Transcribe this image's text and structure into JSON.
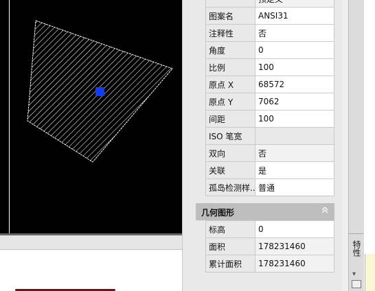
{
  "canvas": {
    "grip_color": "#0d3cff"
  },
  "properties": {
    "top_rows": [
      {
        "key": "",
        "value": "预定义"
      },
      {
        "key": "图案名",
        "value": "ANSI31"
      },
      {
        "key": "注释性",
        "value": "否"
      },
      {
        "key": "角度",
        "value": "0"
      },
      {
        "key": "比例",
        "value": "100"
      },
      {
        "key": "原点 X",
        "value": "68572"
      },
      {
        "key": "原点 Y",
        "value": "7062"
      },
      {
        "key": "间距",
        "value": "100"
      },
      {
        "key": "ISO 笔宽",
        "value": ""
      },
      {
        "key": "双向",
        "value": "否"
      },
      {
        "key": "关联",
        "value": "是"
      },
      {
        "key": "孤岛检测样...",
        "value": "普通"
      }
    ],
    "geometry": {
      "title": "几何图形",
      "collapse_icon": "chevron-up-icon",
      "rows": [
        {
          "key": "标高",
          "value": "0"
        },
        {
          "key": "面积",
          "value": "178231460"
        },
        {
          "key": "累计面积",
          "value": "178231460"
        }
      ]
    }
  },
  "side_strip": {
    "title": "特性"
  }
}
